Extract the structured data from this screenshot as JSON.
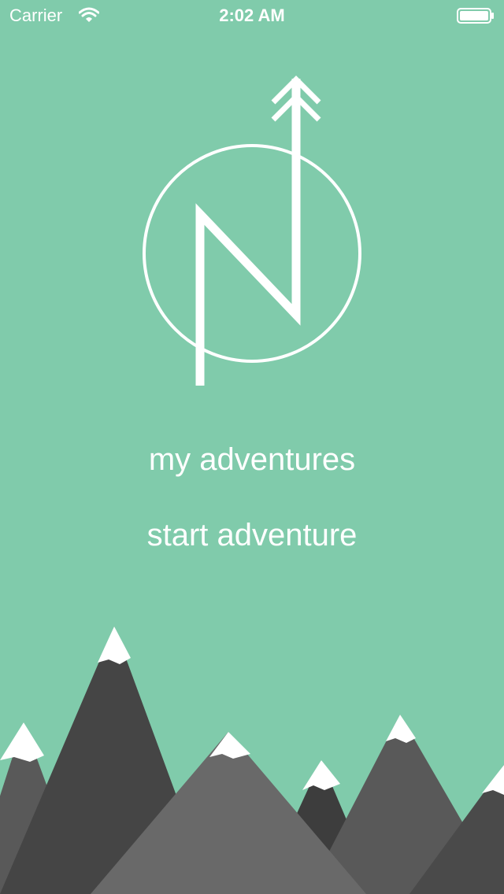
{
  "status_bar": {
    "carrier": "Carrier",
    "time": "2:02 AM",
    "icons": [
      "wifi-icon",
      "battery-icon"
    ]
  },
  "logo": {
    "icon": "north-compass-logo-icon"
  },
  "menu": {
    "my_adventures": "my adventures",
    "start_adventure": "start adventure"
  },
  "illustration": {
    "icon": "mountain-range-illustration"
  },
  "colors": {
    "background": "#80cbab",
    "text": "#ffffff",
    "mountain_dark": "#454545",
    "mountain_mid": "#595959",
    "mountain_light": "#696969",
    "snow": "#ffffff"
  }
}
